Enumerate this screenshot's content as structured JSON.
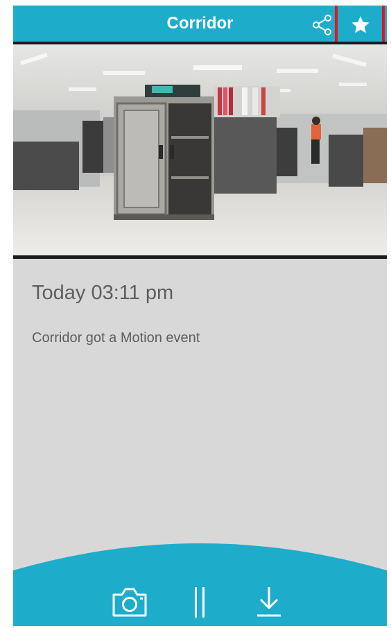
{
  "header": {
    "title": "Corridor",
    "share_icon": "share-icon",
    "favorite_icon": "star-icon",
    "highlight_color": "#e8121d"
  },
  "video": {
    "feed_icon": "camera-feed"
  },
  "event": {
    "time": "Today 03:11 pm",
    "description": "Corridor got a Motion event"
  },
  "controls": {
    "snapshot_icon": "camera-icon",
    "pause_icon": "pause-icon",
    "download_icon": "download-icon"
  },
  "colors": {
    "accent": "#1eaccb",
    "background": "#d8d8d8",
    "text": "#5e5e5e"
  }
}
